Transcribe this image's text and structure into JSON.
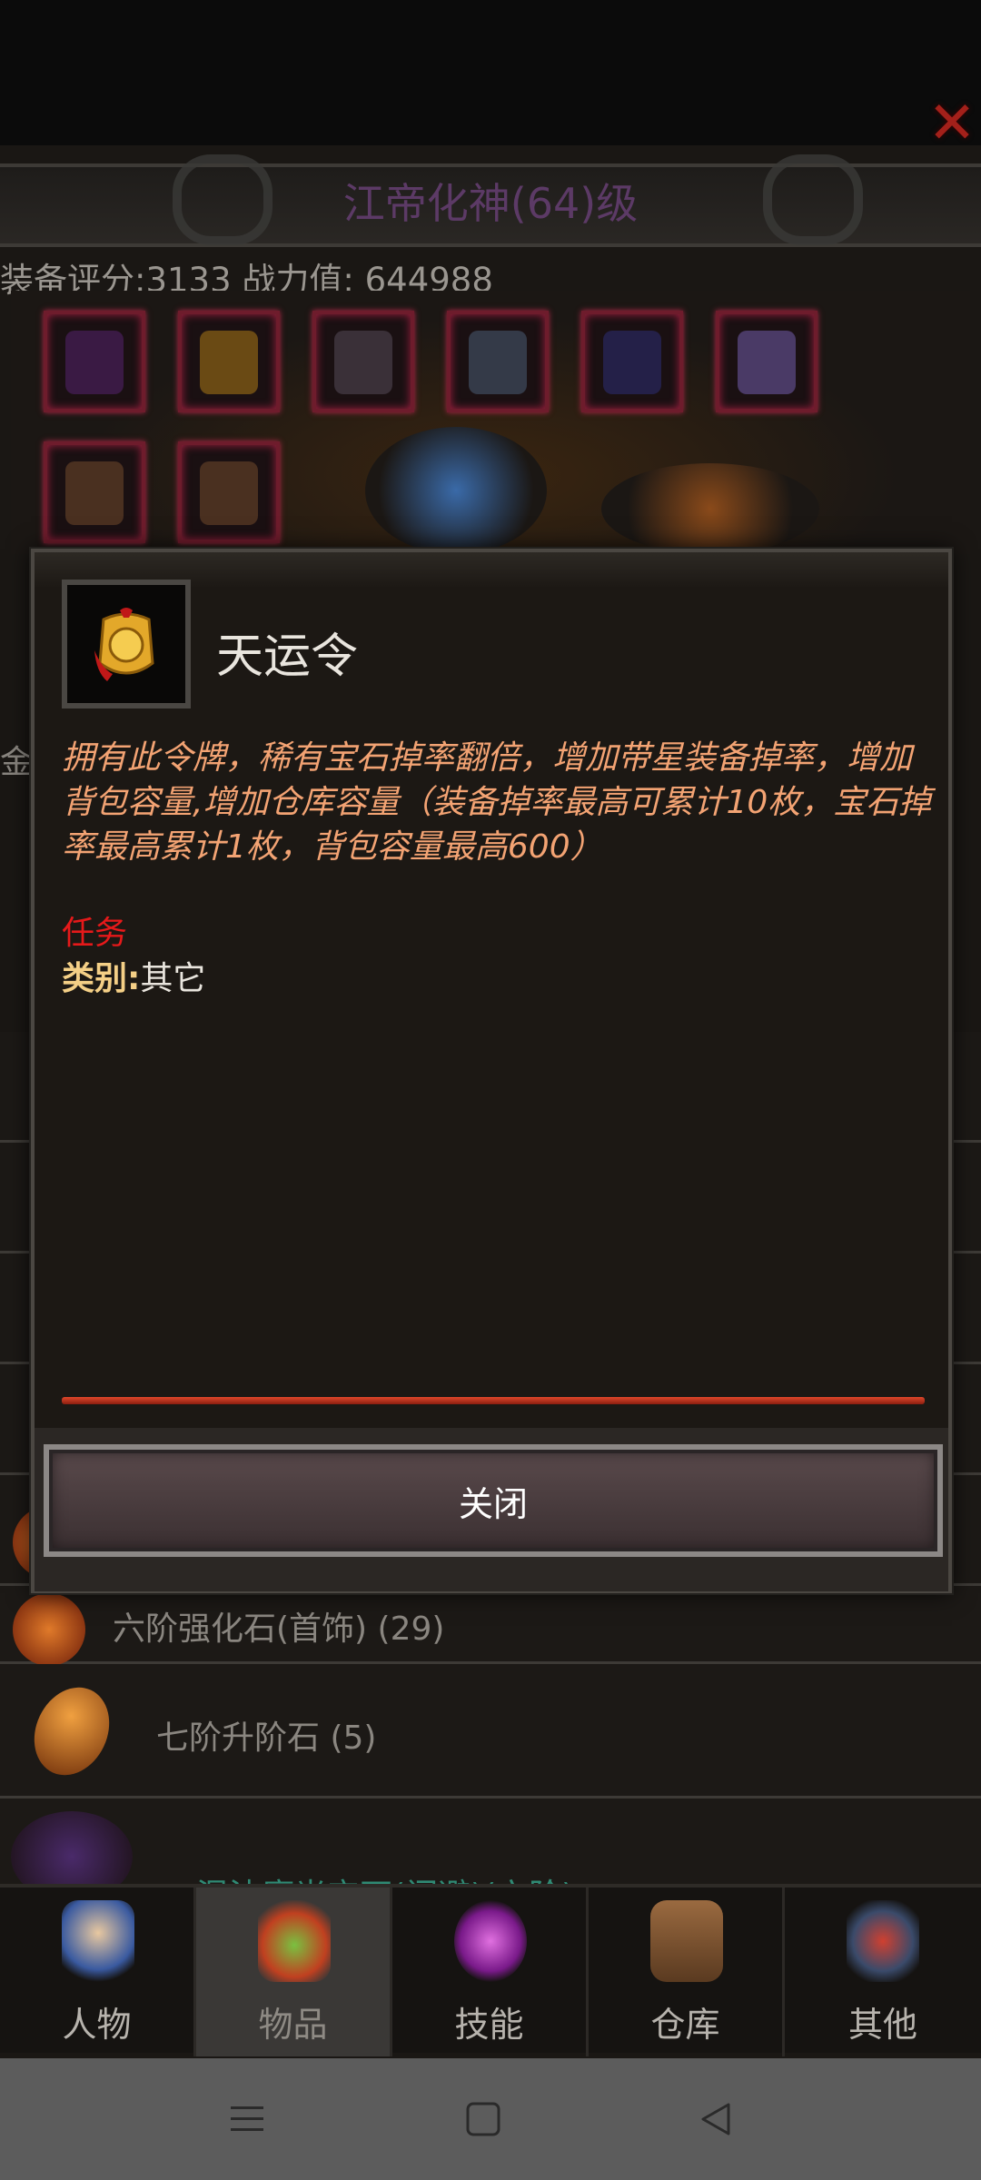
{
  "header": {
    "character_title": "江帝化神(64)级",
    "stats_line": "装备评分:3133 战力值:  644988"
  },
  "partial_side_text": "金",
  "inventory": {
    "rows": [
      {
        "label": "六阶强化石(首饰) (29)"
      },
      {
        "label": "七阶升阶石 (5)"
      },
      {
        "label": "混沌魔光宝石(闪避)(六阶)"
      }
    ]
  },
  "tabs": [
    {
      "label": "人物"
    },
    {
      "label": "物品"
    },
    {
      "label": "技能"
    },
    {
      "label": "仓库"
    },
    {
      "label": "其他"
    }
  ],
  "dialog": {
    "item_name": "天运令",
    "description": "拥有此令牌，稀有宝石掉率翻倍，增加带星装备掉率，增加背包容量,增加仓库容量（装备掉率最高可累计10枚，宝石掉率最高累计1枚，背包容量最高600）",
    "tag": "任务",
    "category_label": "类别:",
    "category_value": "其它",
    "close_label": "关闭"
  },
  "colors": {
    "accent_red": "#e6191a",
    "description_orange": "#f3a373",
    "category_gold": "#f4cf86"
  }
}
